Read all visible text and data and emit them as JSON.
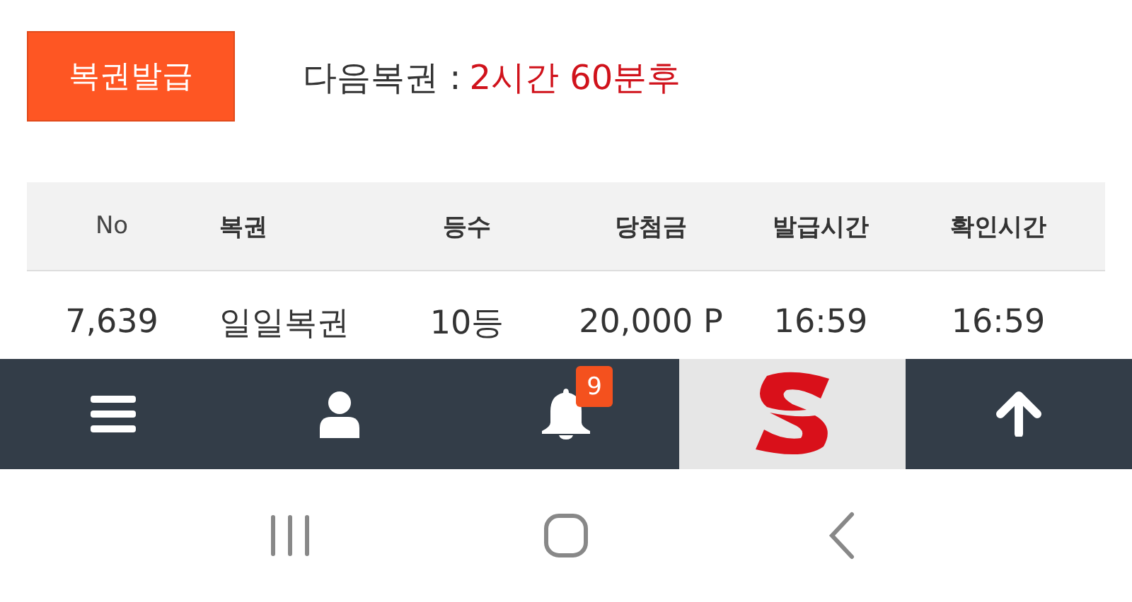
{
  "issue_button": {
    "label": "복권발급"
  },
  "next_lottery": {
    "label": "다음복권 :",
    "value": "2시간 60분후"
  },
  "table": {
    "columns": [
      "No",
      "복권",
      "등수",
      "당첨금",
      "발급시간",
      "확인시간"
    ],
    "rows": [
      [
        "7,639",
        "일일복권",
        "10등",
        "20,000 P",
        "16:59",
        "16:59"
      ]
    ]
  },
  "bottom_nav": [
    {
      "kind": "menu"
    },
    {
      "kind": "user"
    },
    {
      "kind": "bell",
      "badge": "9"
    },
    {
      "kind": "logo"
    },
    {
      "kind": "up"
    }
  ],
  "system_nav": [
    {
      "kind": "recents"
    },
    {
      "kind": "home"
    },
    {
      "kind": "back"
    }
  ]
}
